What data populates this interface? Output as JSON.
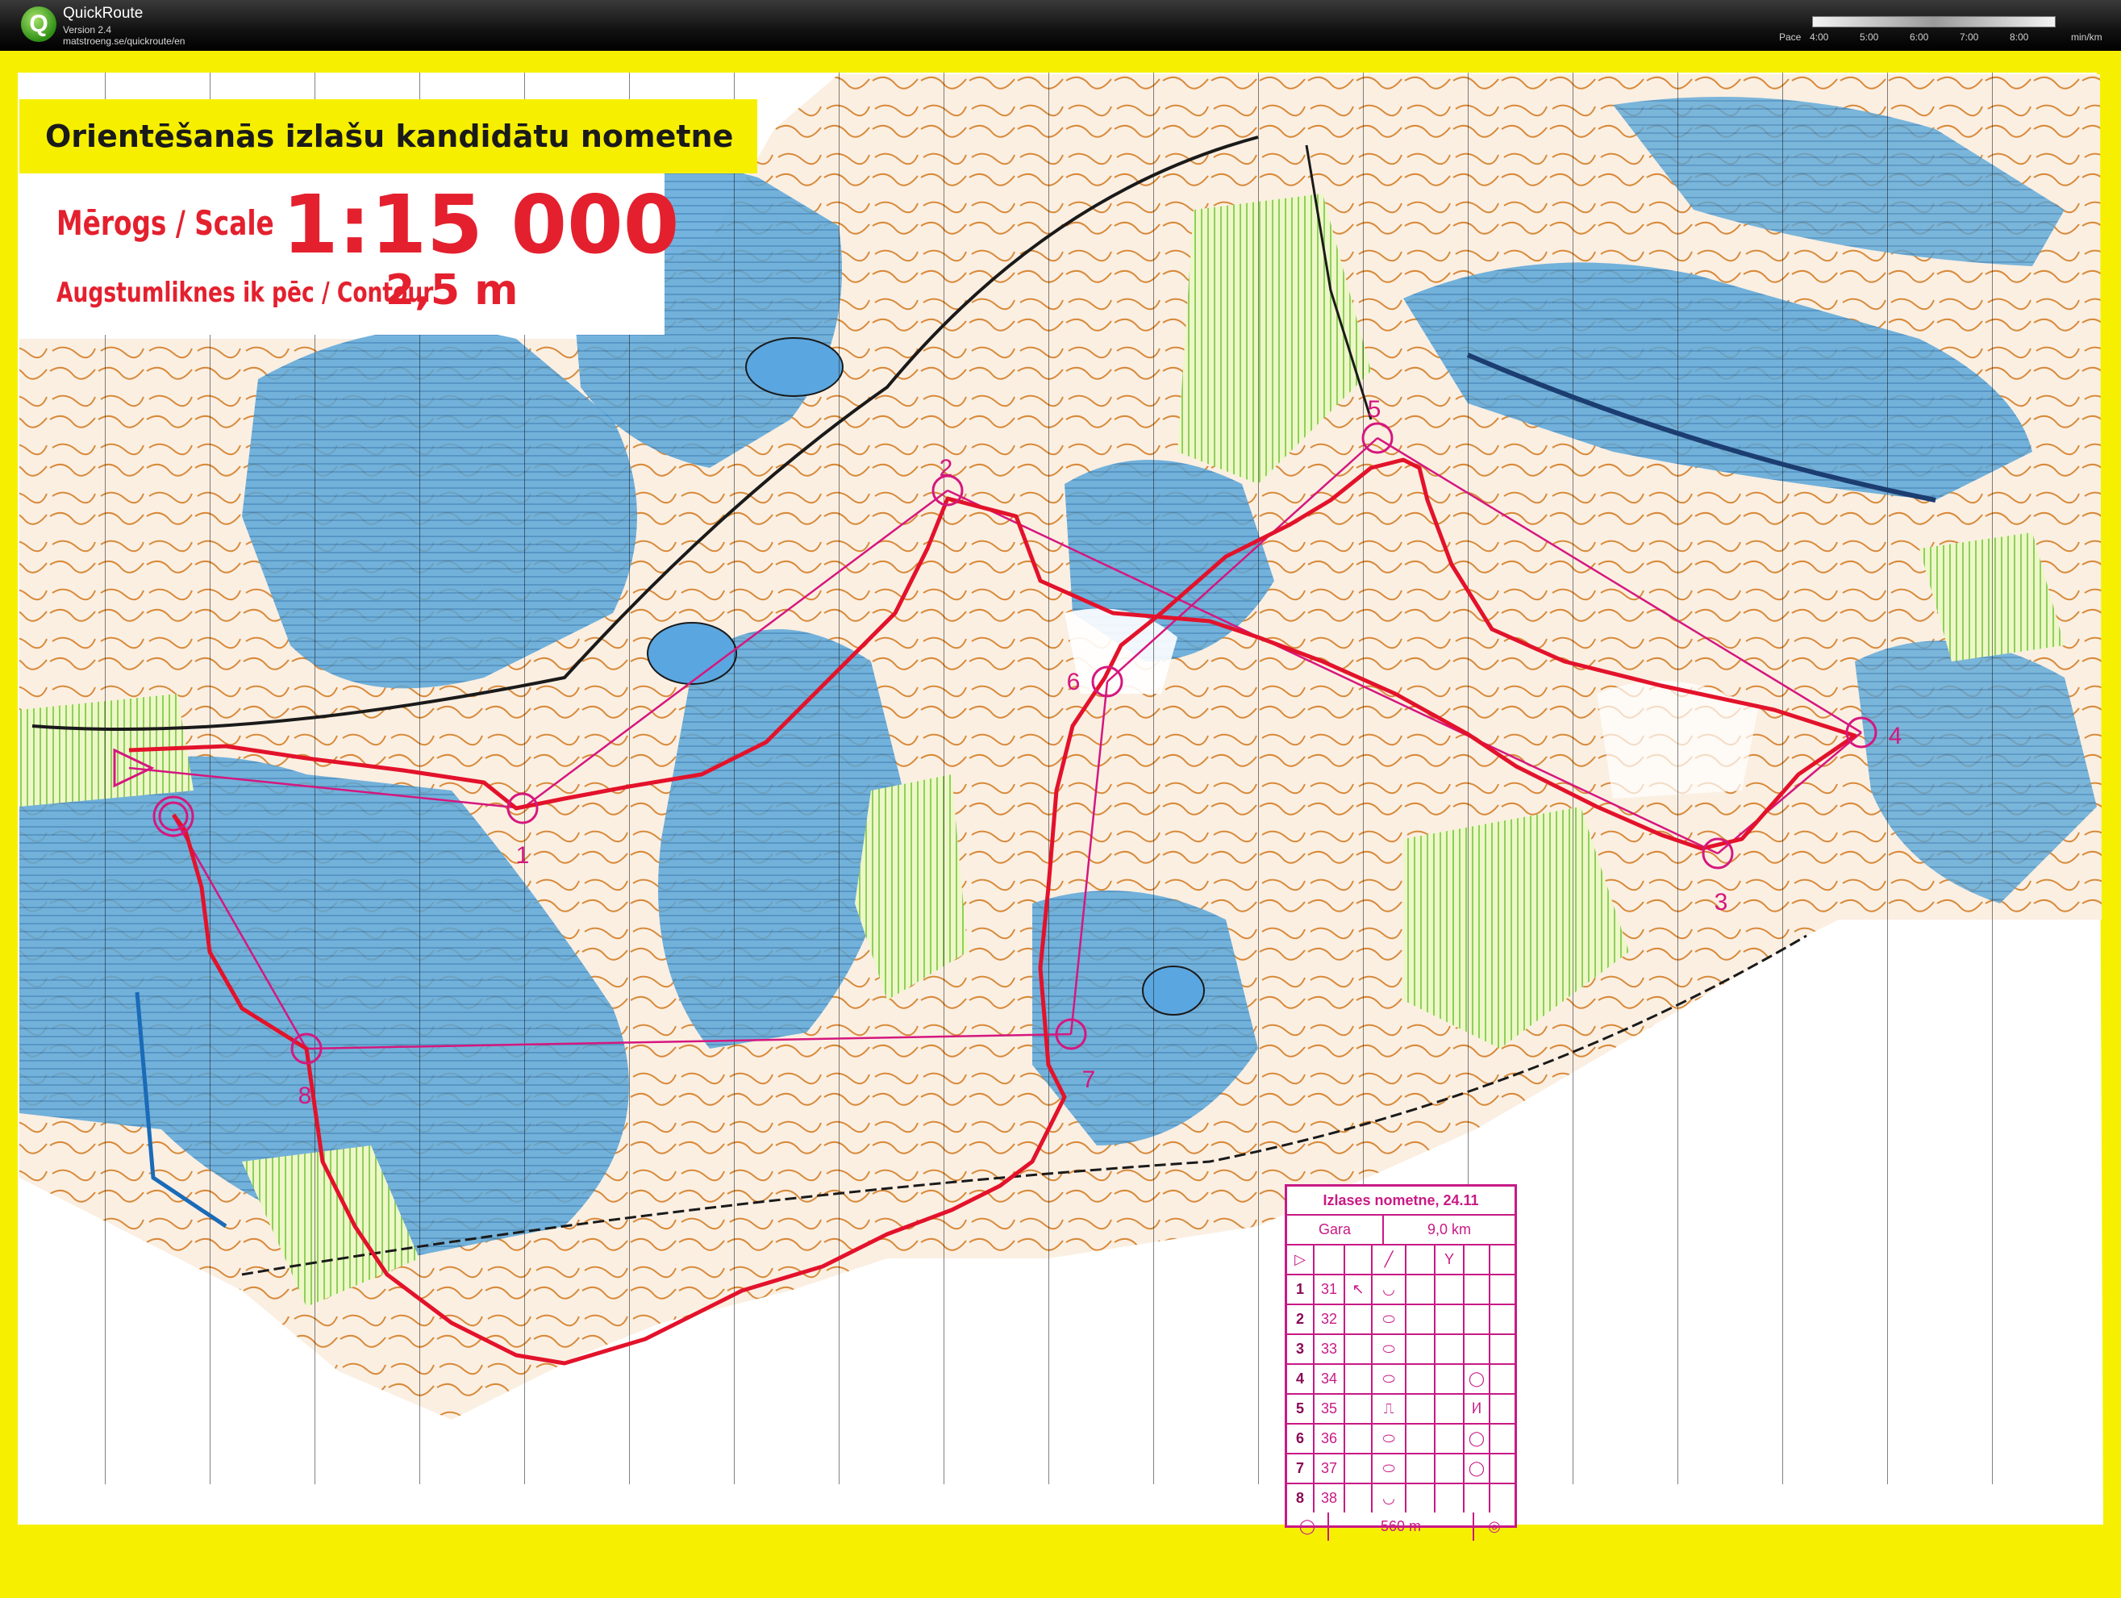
{
  "app": {
    "name": "QuickRoute",
    "version": "Version 2.4",
    "url": "matstroeng.se/quickroute/en",
    "logo_letter": "Q"
  },
  "pace_scale": {
    "label": "Pace",
    "ticks": [
      "4:00",
      "5:00",
      "6:00",
      "7:00",
      "8:00"
    ],
    "unit": "min/km"
  },
  "map_header": {
    "title": "Orientēšanās izlašu kandidātu nometne",
    "scale_label": "Mērogs / Scale",
    "scale_value": "1:15 000",
    "contour_label": "Augstumliknes ik pēc / Contour",
    "contour_value": "2,5 m"
  },
  "course": {
    "controls": [
      {
        "id": "start",
        "label": ""
      },
      {
        "id": "1",
        "label": "1"
      },
      {
        "id": "2",
        "label": "2"
      },
      {
        "id": "3",
        "label": "3"
      },
      {
        "id": "4",
        "label": "4"
      },
      {
        "id": "5",
        "label": "5"
      },
      {
        "id": "6",
        "label": "6"
      },
      {
        "id": "7",
        "label": "7"
      },
      {
        "id": "8",
        "label": "8"
      }
    ]
  },
  "description_sheet": {
    "title": "Izlases nometne, 24.11",
    "course_name": "Gara",
    "length": "9,0 km",
    "rows": [
      {
        "num": "1",
        "code": "31"
      },
      {
        "num": "2",
        "code": "32"
      },
      {
        "num": "3",
        "code": "33"
      },
      {
        "num": "4",
        "code": "34"
      },
      {
        "num": "5",
        "code": "35"
      },
      {
        "num": "6",
        "code": "36"
      },
      {
        "num": "7",
        "code": "37"
      },
      {
        "num": "8",
        "code": "38"
      }
    ],
    "finish_distance": "560 m"
  },
  "colors": {
    "frame_yellow": "#f6f000",
    "course_magenta": "#d5177e",
    "route_red": "#e3122b",
    "water_blue": "#4e9fd4",
    "contour_brown": "#d88a3a",
    "vegetation_green": "#a9d97c"
  }
}
